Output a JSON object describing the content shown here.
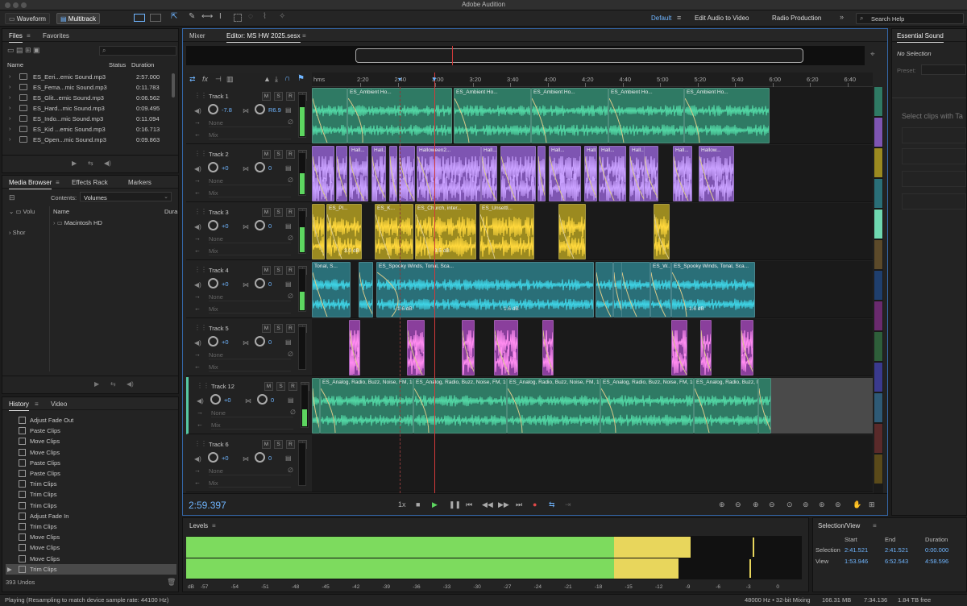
{
  "app": {
    "title": "Adobe Audition"
  },
  "toolbar": {
    "waveform": "Waveform",
    "multitrack": "Multitrack",
    "default": "Default",
    "edit_audio": "Edit Audio to Video",
    "radio": "Radio Production",
    "search_placeholder": "Search Help"
  },
  "files_panel": {
    "tab_files": "Files",
    "tab_favorites": "Favorites",
    "col_name": "Name",
    "col_status": "Status",
    "col_duration": "Duration",
    "files": [
      {
        "name": "ES_Eeri...emic Sound.mp3",
        "duration": "2:57.000"
      },
      {
        "name": "ES_Fema...mic Sound.mp3",
        "duration": "0:11.783"
      },
      {
        "name": "ES_Glit...emic Sound.mp3",
        "duration": "0:06.562"
      },
      {
        "name": "ES_Hard...mic Sound.mp3",
        "duration": "0:09.495"
      },
      {
        "name": "ES_Indo...mic Sound.mp3",
        "duration": "0:11.094"
      },
      {
        "name": "ES_Kid ...emic Sound.mp3",
        "duration": "0:16.713"
      },
      {
        "name": "ES_Open...mic Sound.mp3",
        "duration": "0:09.863"
      }
    ]
  },
  "media_browser": {
    "tab_media": "Media Browser",
    "tab_effects": "Effects Rack",
    "tab_markers": "Markers",
    "contents_label": "Contents:",
    "contents_value": "Volumes",
    "col_name": "Name",
    "col_dur": "Dura",
    "tree_volumes": "Volu",
    "tree_shortcuts": "Shor",
    "item": "Macintosh HD"
  },
  "history": {
    "tab_history": "History",
    "tab_video": "Video",
    "undos": "393 Undos",
    "items": [
      "Adjust Fade Out",
      "Paste Clips",
      "Move Clips",
      "Move Clips",
      "Paste Clips",
      "Paste Clips",
      "Trim Clips",
      "Trim Clips",
      "Trim Clips",
      "Adjust Fade In",
      "Trim Clips",
      "Move Clips",
      "Move Clips",
      "Move Clips",
      "Trim Clips"
    ]
  },
  "editor": {
    "tab_mixer": "Mixer",
    "tab_editor": "Editor: MS HW 2025.sesx",
    "ruler": [
      "hms",
      "2:20",
      "2:40",
      "3:00",
      "3:20",
      "3:40",
      "4:00",
      "4:20",
      "4:40",
      "5:00",
      "5:20",
      "5:40",
      "6:00",
      "6:20",
      "6:40"
    ],
    "timecode": "2:59.397",
    "speed": "1x",
    "tracks": [
      {
        "name": "Track 1",
        "vol": "-7.8",
        "pan": "R6.9",
        "input": "None",
        "mix": "Mix",
        "meter": 0.7
      },
      {
        "name": "Track 2",
        "vol": "+0",
        "pan": "0",
        "input": "None",
        "mix": "Mix",
        "meter": 0.5
      },
      {
        "name": "Track 3",
        "vol": "+0",
        "pan": "0",
        "input": "None",
        "mix": "Mix",
        "meter": 0.6
      },
      {
        "name": "Track 4",
        "vol": "+0",
        "pan": "0",
        "input": "None",
        "mix": "Mix",
        "meter": 0.45
      },
      {
        "name": "Track 5",
        "vol": "+0",
        "pan": "0",
        "input": "None",
        "mix": "Mix",
        "meter": 0.0
      },
      {
        "name": "Track 12",
        "vol": "+0",
        "pan": "0",
        "input": "None",
        "mix": "Mix",
        "meter": 0.4
      },
      {
        "name": "Track 6",
        "vol": "+0",
        "pan": "0",
        "input": "None",
        "mix": "Mix",
        "meter": 0.0
      }
    ],
    "clip_labels": {
      "t1": "ES_Ambient Ho...",
      "t2": "Hall...",
      "t2b": "Halloween2...",
      "t2c": "Hallow...",
      "t3a": "ES_Pl...",
      "t3b": "ES_K...",
      "t3c": "ES_Church, inter...",
      "t3d": "ES_Unsettl...",
      "t3gain": "3.0 dB",
      "t3gain2": "3.5 dB",
      "t4a": "Tonal, S...",
      "t4b": "ES_Spooky Winds, Tonal, Sca...",
      "t4c": "ES_W...",
      "t4gain": "- 1.6 dB",
      "t12a": "ES_Analog, Radio, Buzz, Noise, FM, 100K..."
    }
  },
  "essential_sound": {
    "title": "Essential Sound",
    "no_selection": "No Selection",
    "preset": "Preset:",
    "hint": "Select clips with Ta"
  },
  "levels": {
    "title": "Levels",
    "scale": [
      "dB",
      "-57",
      "-54",
      "-51",
      "-48",
      "-45",
      "-42",
      "-39",
      "-36",
      "-33",
      "-30",
      "-27",
      "-24",
      "-21",
      "-18",
      "-15",
      "-12",
      "-9",
      "-6",
      "-3",
      "0"
    ],
    "level_top": 0.82,
    "level_bottom": 0.8
  },
  "selection_view": {
    "title": "Selection/View",
    "col_start": "Start",
    "col_end": "End",
    "col_duration": "Duration",
    "row_selection": "Selection",
    "row_view": "View",
    "sel_start": "2:41.521",
    "sel_end": "2:41.521",
    "sel_dur": "0:00.000",
    "view_start": "1:53.946",
    "view_end": "6:52.543",
    "view_dur": "4:58.596"
  },
  "status": {
    "left": "Playing (Resampling to match device sample rate: 44100 Hz)",
    "rate": "48000 Hz • 32-bit Mixing",
    "mem": "166.31 MB",
    "time": "7:34.136",
    "free": "1.84 TB free"
  },
  "colors": {
    "green_clip": "#2f7a64",
    "purple_clip": "#7e55b2",
    "yellow_clip": "#9b8a20",
    "teal_clip": "#2a6f78",
    "magenta_clip": "#8a3f9c",
    "accent": "#2d8ceb"
  }
}
